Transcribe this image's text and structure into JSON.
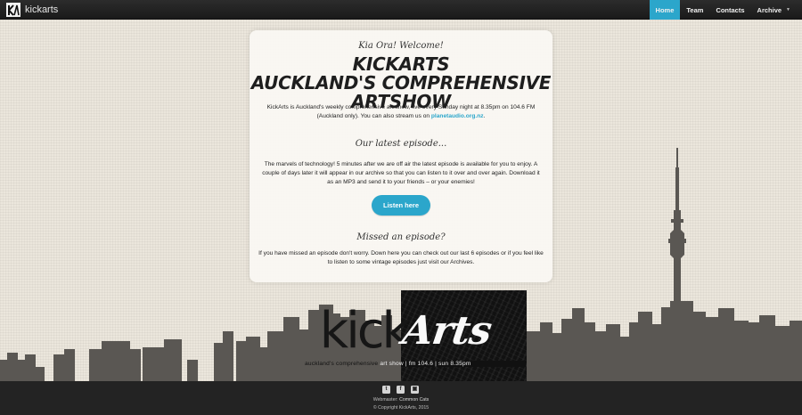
{
  "navbar": {
    "brand": "kickarts",
    "items": [
      {
        "label": "Home",
        "active": true
      },
      {
        "label": "Team"
      },
      {
        "label": "Contacts"
      },
      {
        "label": "Archive",
        "has_caret": true
      }
    ]
  },
  "card": {
    "greeting": "Kia Ora! Welcome!",
    "title_line1": "KickArts",
    "title_line2": "Auckland's Comprehensive Artshow",
    "intro_text": "KickArts is Auckland's weekly comprehensive art show, live every Sunday night at 8.35pm on 104.6 FM (Auckland only). You can also stream us on",
    "intro_link": "planetaudio.org.nz",
    "intro_end": ".",
    "latest_heading": "Our latest episode...",
    "latest_text": "The marvels of technology! 5 minutes after we are off air the latest episode is available for you to enjoy. A couple of days later it will appear in our archive so that you can listen to it over and over again. Download it as an MP3 and send it to your friends – or your enemies!",
    "listen_button": "Listen here",
    "missed_heading": "Missed an episode?",
    "missed_text": "If you have missed an episode don't worry. Down here you can check out our last 6 episodes or if you feel like to listen to some vintage episodes just visit our Archives."
  },
  "logo": {
    "kick": "kick",
    "arts": "Arts",
    "tagline_dark": "auckland's comprehensive ",
    "tagline_light": "art show | fm 104.6 | sun 8.35pm"
  },
  "footer": {
    "social": [
      {
        "icon": "twitter-icon",
        "glyph": "t"
      },
      {
        "icon": "facebook-icon",
        "glyph": "f"
      },
      {
        "icon": "instagram-icon",
        "glyph": "▣"
      }
    ],
    "webmaster_label": "Webmaster:",
    "webmaster_name": "Common Cats",
    "copyright": "© Copyright KickArts, 2015"
  },
  "colors": {
    "accent": "#2ba6cb",
    "navbar": "#222222",
    "footer": "#232323",
    "skyline": "#5a5753",
    "background": "#ebe6dc"
  }
}
